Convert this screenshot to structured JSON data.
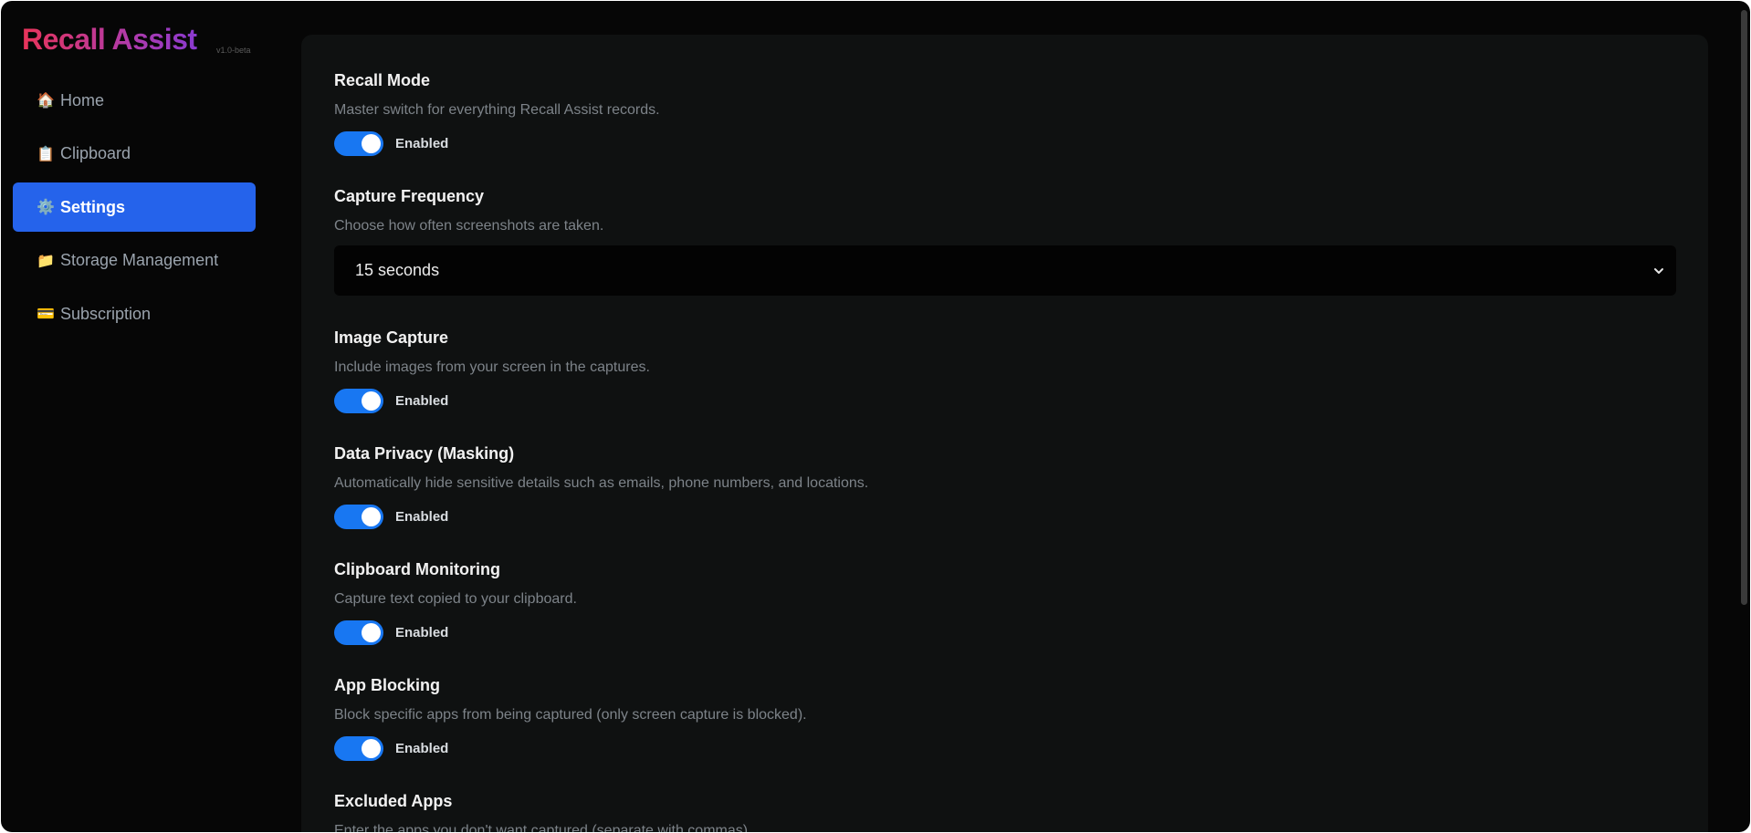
{
  "app": {
    "title": "Recall Assist",
    "version": "v1.0-beta"
  },
  "sidebar": {
    "items": [
      {
        "label": "Home",
        "icon": "🏠"
      },
      {
        "label": "Clipboard",
        "icon": "📋"
      },
      {
        "label": "Settings",
        "icon": "⚙️",
        "active": true
      },
      {
        "label": "Storage Management",
        "icon": "📁"
      },
      {
        "label": "Subscription",
        "icon": "💳"
      }
    ]
  },
  "settings": {
    "recall_mode": {
      "title": "Recall Mode",
      "desc": "Master switch for everything Recall Assist records.",
      "state": "Enabled"
    },
    "capture_frequency": {
      "title": "Capture Frequency",
      "desc": "Choose how often screenshots are taken.",
      "value": "15 seconds"
    },
    "image_capture": {
      "title": "Image Capture",
      "desc": "Include images from your screen in the captures.",
      "state": "Enabled"
    },
    "data_privacy": {
      "title": "Data Privacy (Masking)",
      "desc": "Automatically hide sensitive details such as emails, phone numbers, and locations.",
      "state": "Enabled"
    },
    "clipboard_monitoring": {
      "title": "Clipboard Monitoring",
      "desc": "Capture text copied to your clipboard.",
      "state": "Enabled"
    },
    "app_blocking": {
      "title": "App Blocking",
      "desc": "Block specific apps from being captured (only screen capture is blocked).",
      "state": "Enabled"
    },
    "excluded_apps": {
      "title": "Excluded Apps",
      "desc": "Enter the apps you don't want captured (separate with commas)."
    }
  },
  "colors": {
    "accent": "#2563eb",
    "toggle_on": "#1877f2"
  }
}
